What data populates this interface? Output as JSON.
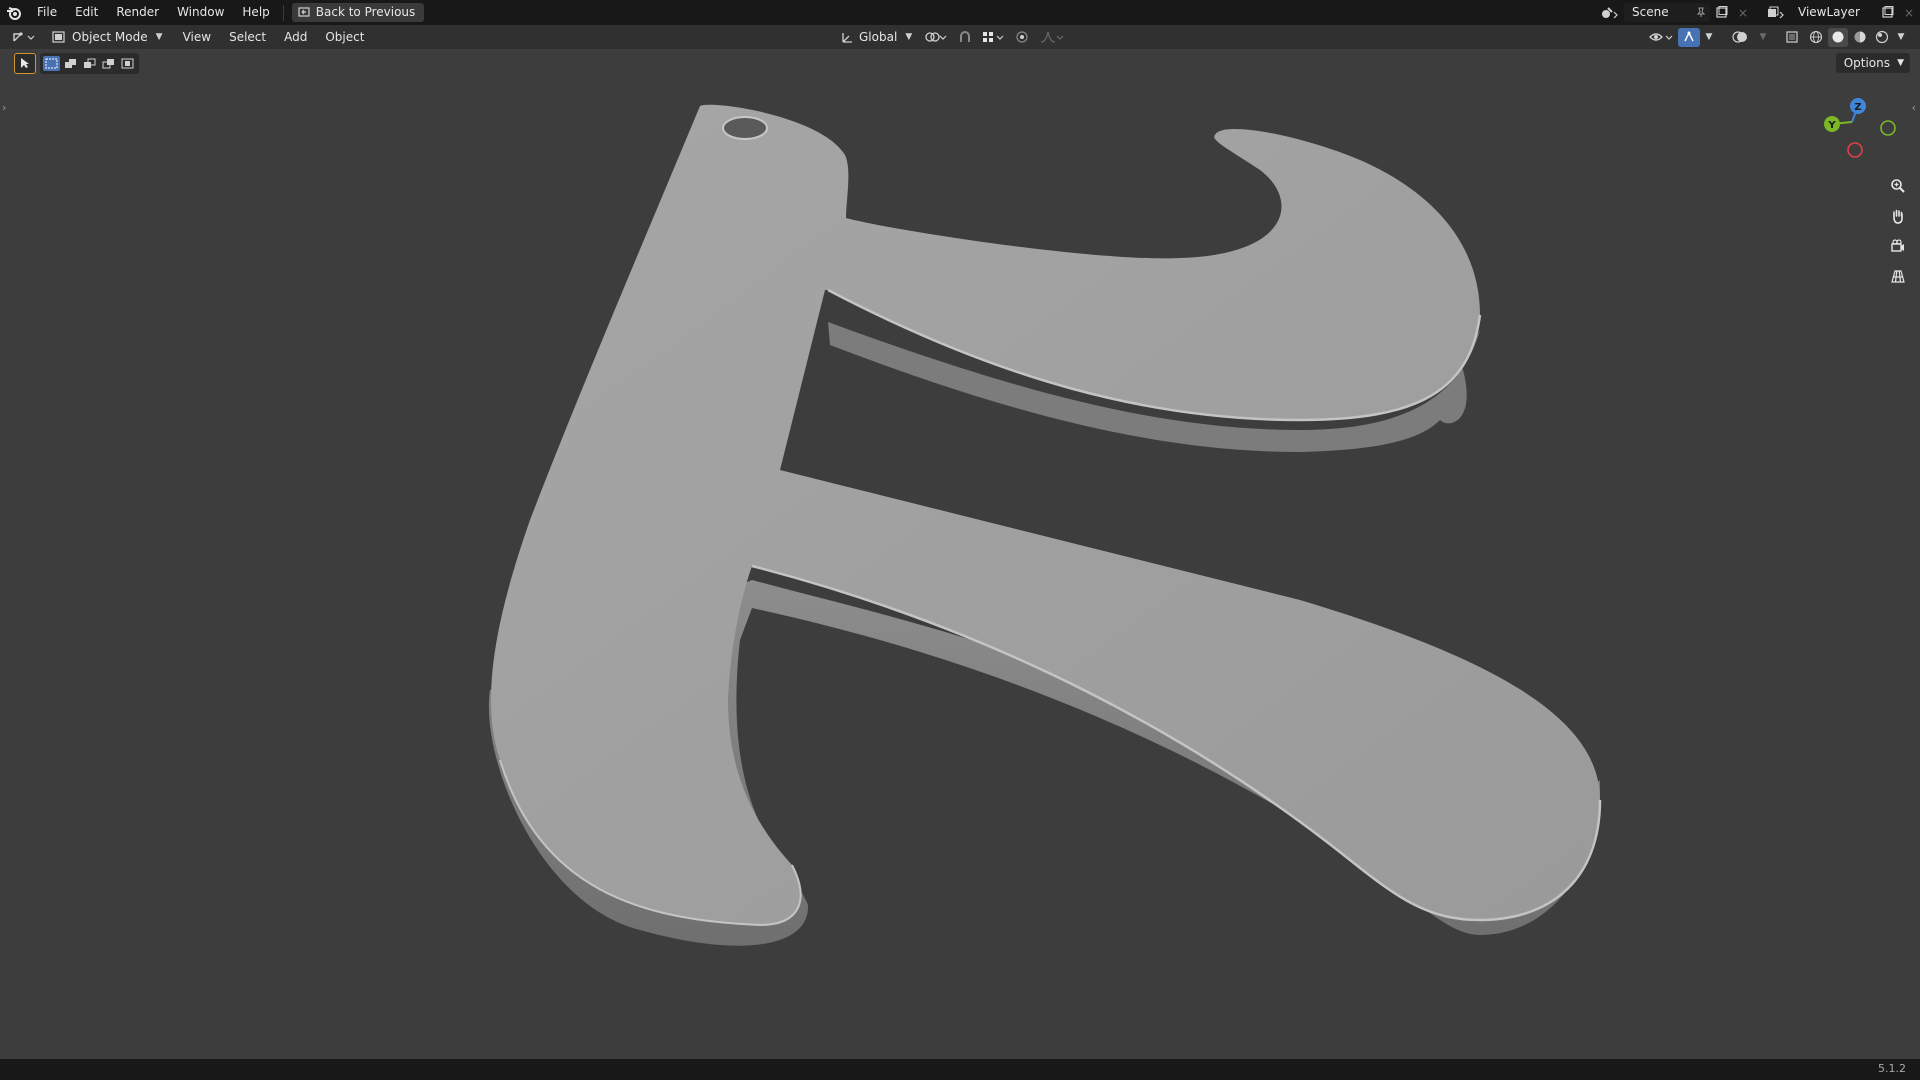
{
  "menus": [
    "File",
    "Edit",
    "Render",
    "Window",
    "Help"
  ],
  "back_button": "Back to Previous",
  "scene": {
    "label": "Scene"
  },
  "view_layer": {
    "label": "ViewLayer"
  },
  "header": {
    "mode": "Object Mode",
    "menus": [
      "View",
      "Select",
      "Add",
      "Object"
    ],
    "orientation": "Global"
  },
  "options_label": "Options",
  "gizmo": {
    "z": "Z",
    "y": "Y"
  },
  "status": {
    "version": "5.1.2"
  },
  "icons": {
    "app": "blender-logo-icon",
    "editor_type": "3d-viewport-icon",
    "zoom": "zoom-icon",
    "pan": "hand-icon",
    "camera": "camera-icon",
    "ortho": "grid-icon"
  },
  "colors": {
    "axis_x": "#e0404a",
    "axis_y": "#7cb823",
    "axis_z": "#3f86d9",
    "active_shading": "#e8e8e8",
    "accent": "#4772b3"
  }
}
